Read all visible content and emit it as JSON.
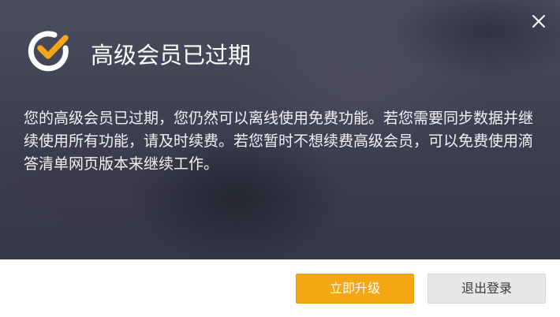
{
  "dialog": {
    "title": "高级会员已过期",
    "message": "您的高级会员已过期，您仍然可以离线使用免费功能。若您需要同步数据并继续使用所有功能，请及时续费。若您暂时不想续费高级会员，可以免费使用滴答清单网页版本来继续工作。",
    "logo_icon": "ticktick-check-logo-icon",
    "close_icon": "close-icon"
  },
  "buttons": {
    "upgrade_label": "立即升级",
    "logout_label": "退出登录"
  },
  "colors": {
    "upgrade_button": "#f5a614",
    "logout_button": "#e6e7e8",
    "header_background": "#3e4152",
    "logo_check": "#f5a614"
  }
}
